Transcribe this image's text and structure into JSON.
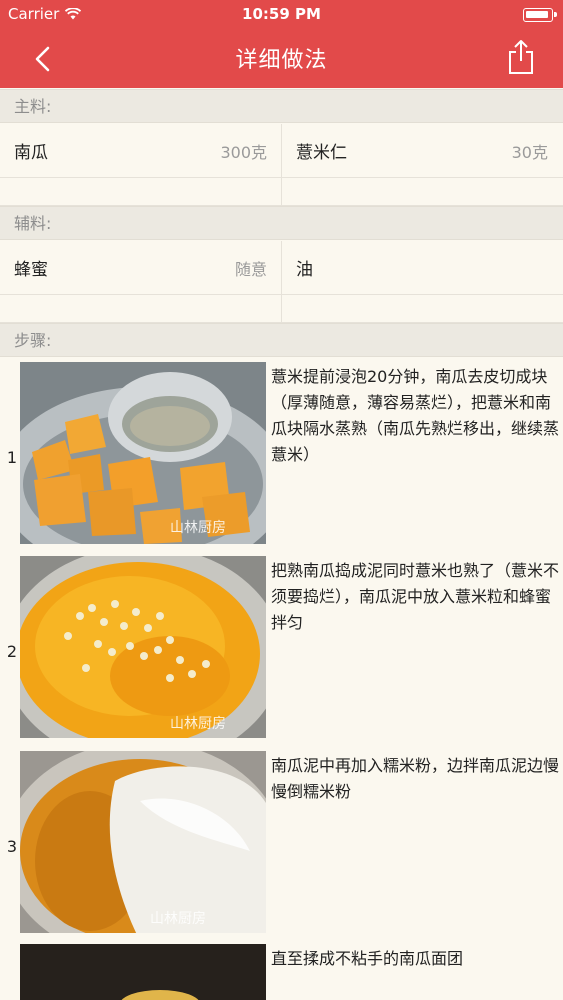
{
  "status_bar": {
    "carrier": "Carrier",
    "time": "10:59 PM"
  },
  "nav": {
    "title": "详细做法",
    "back_icon": "chevron-left-icon",
    "share_icon": "share-icon"
  },
  "main_ingredients": {
    "header": "主料:",
    "items": [
      {
        "name": "南瓜",
        "amount": "300克"
      },
      {
        "name": "薏米仁",
        "amount": "30克"
      }
    ]
  },
  "aux_ingredients": {
    "header": "辅料:",
    "items": [
      {
        "name": "蜂蜜",
        "amount": "随意"
      },
      {
        "name": "油",
        "amount": ""
      }
    ]
  },
  "steps": {
    "header": "步骤:",
    "items": [
      {
        "number": "1",
        "text": "薏米提前浸泡20分钟，南瓜去皮切成块（厚薄随意，薄容易蒸烂），把薏米和南瓜块隔水蒸熟（南瓜先熟烂移出，继续蒸薏米）",
        "watermark": "山林厨房"
      },
      {
        "number": "2",
        "text": "把熟南瓜捣成泥同时薏米也熟了（薏米不须要捣烂），南瓜泥中放入薏米粒和蜂蜜拌匀",
        "watermark": "山林厨房"
      },
      {
        "number": "3",
        "text": "南瓜泥中再加入糯米粉，边拌南瓜泥边慢慢倒糯米粉",
        "watermark": "山林厨房"
      },
      {
        "number": "",
        "text": "直至揉成不粘手的南瓜面团",
        "watermark": ""
      }
    ]
  },
  "colors": {
    "nav_bg": "#e24a4a",
    "page_bg": "#fbf8ef",
    "section_bg": "#ece9e1"
  }
}
